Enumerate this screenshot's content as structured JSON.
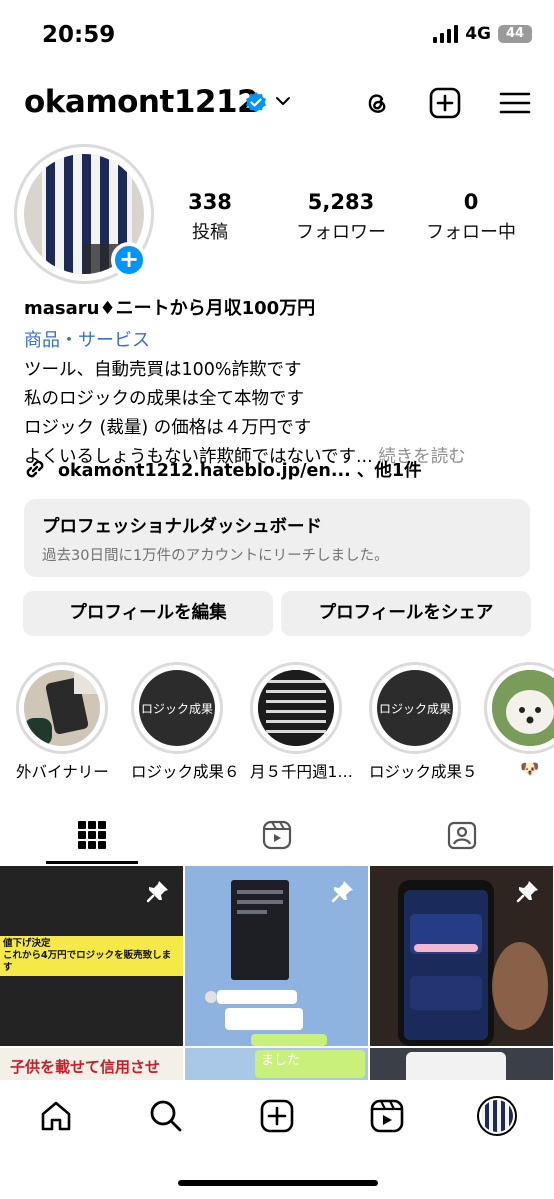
{
  "status_bar": {
    "time": "20:59",
    "network": "4G",
    "battery": "44"
  },
  "header": {
    "username": "okamont1212"
  },
  "stats": [
    {
      "value": "338",
      "label": "投稿"
    },
    {
      "value": "5,283",
      "label": "フォロワー"
    },
    {
      "value": "0",
      "label": "フォロー中"
    }
  ],
  "bio": {
    "name": "masaru♦ニートから月収100万円",
    "category": "商品・サービス",
    "lines": [
      "ツール、自動売買は100%詐欺です",
      "私のロジックの成果は全て本物です",
      "ロジック (裁量) の価格は４万円です",
      "よくいるしょうもない詐欺師ではないです..."
    ],
    "more_label": "続きを読む",
    "link": "okamont1212.hateblo.jp/en... 、他1件"
  },
  "dashboard": {
    "title": "プロフェッショナルダッシュボード",
    "subtitle": "過去30日間に1万件のアカウントにリーチしました。"
  },
  "buttons": {
    "edit": "プロフィールを編集",
    "share": "プロフィールをシェア"
  },
  "highlights": [
    {
      "label": "外バイナリー",
      "cover_text": ""
    },
    {
      "label": "ロジック成果６",
      "cover_text": "ロジック成果"
    },
    {
      "label": "月５千円週1…",
      "cover_text": ""
    },
    {
      "label": "ロジック成果５",
      "cover_text": "ロジック成果"
    },
    {
      "label": "🐶",
      "cover_text": ""
    }
  ],
  "grid": {
    "post1_text": "値下げ決定\nこれから4万円でロジックを販売致します",
    "post4_text": "子供を載せて信用させ",
    "post5_text": "ました"
  },
  "colors": {
    "accent": "#0095f6",
    "link": "#3b6fc7",
    "muted": "#737373"
  }
}
